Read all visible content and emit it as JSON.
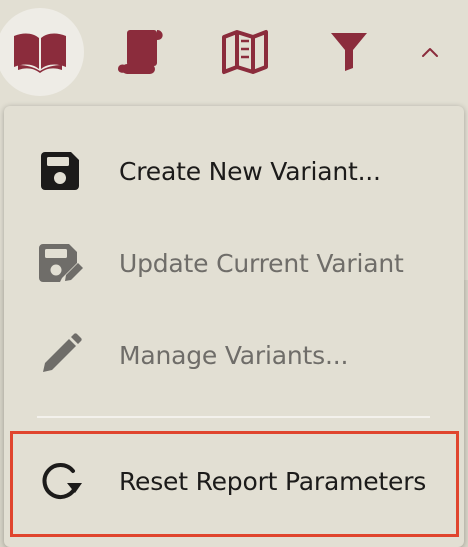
{
  "toolbar": {
    "buttons": [
      {
        "name": "book-icon",
        "active": true
      },
      {
        "name": "scroll-icon",
        "active": false
      },
      {
        "name": "map-icon",
        "active": false
      },
      {
        "name": "filter-icon",
        "active": false
      }
    ],
    "collapse_icon": "chevron-up-icon",
    "accent_color": "#8b2c3c"
  },
  "menu": {
    "items": [
      {
        "label": "Create New Variant...",
        "icon": "floppy-disk-icon",
        "enabled": true
      },
      {
        "label": "Update Current Variant",
        "icon": "floppy-disk-edit-icon",
        "enabled": false
      },
      {
        "label": "Manage Variants...",
        "icon": "pencil-icon",
        "enabled": false
      },
      {
        "label": "Reset Report Parameters",
        "icon": "refresh-icon",
        "enabled": true,
        "highlighted": true
      }
    ]
  },
  "colors": {
    "background": "#e2dfd3",
    "icon_dark": "#1c1b1a",
    "icon_disabled": "#6f6d69",
    "highlight_border": "#e0452e"
  }
}
